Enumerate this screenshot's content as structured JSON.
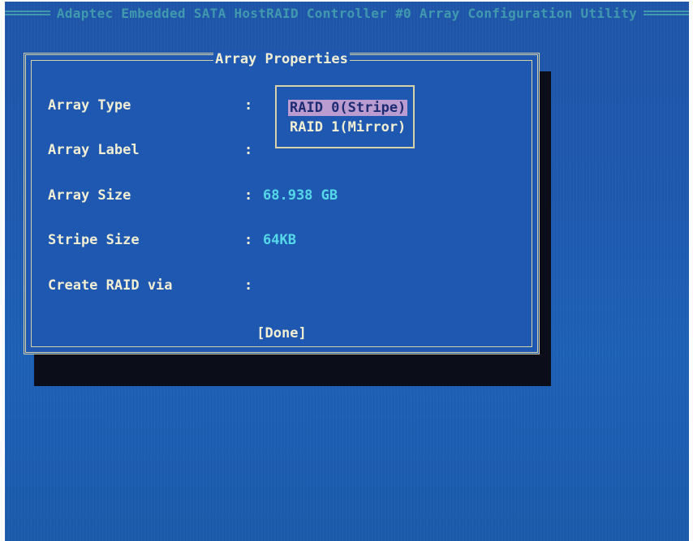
{
  "title_bar": {
    "text": "Adaptec Embedded SATA HostRAID Controller #0 Array Configuration Utility"
  },
  "dialog": {
    "title": "Array Properties",
    "fields": [
      {
        "label": "Array Type",
        "separator": ":",
        "value": ""
      },
      {
        "label": "Array Label",
        "separator": ":",
        "value": ""
      },
      {
        "label": "Array Size",
        "separator": ":",
        "value": "68.938 GB"
      },
      {
        "label": "Stripe Size",
        "separator": ":",
        "value": "64KB"
      },
      {
        "label": "Create RAID via",
        "separator": ":",
        "value": ""
      }
    ],
    "array_type_options": [
      {
        "label": "RAID 0(Stripe)",
        "selected": true
      },
      {
        "label": "RAID 1(Mirror)",
        "selected": false
      }
    ],
    "done_button": "[Done]"
  },
  "colors": {
    "background": "#1f58b0",
    "title_bar_text": "#3f9aae",
    "label_text": "#f1eed4",
    "value_text": "#55d9e8",
    "border": "#d8d2a6",
    "selection": "#bb9cd0",
    "shadow": "#0b0d18"
  }
}
